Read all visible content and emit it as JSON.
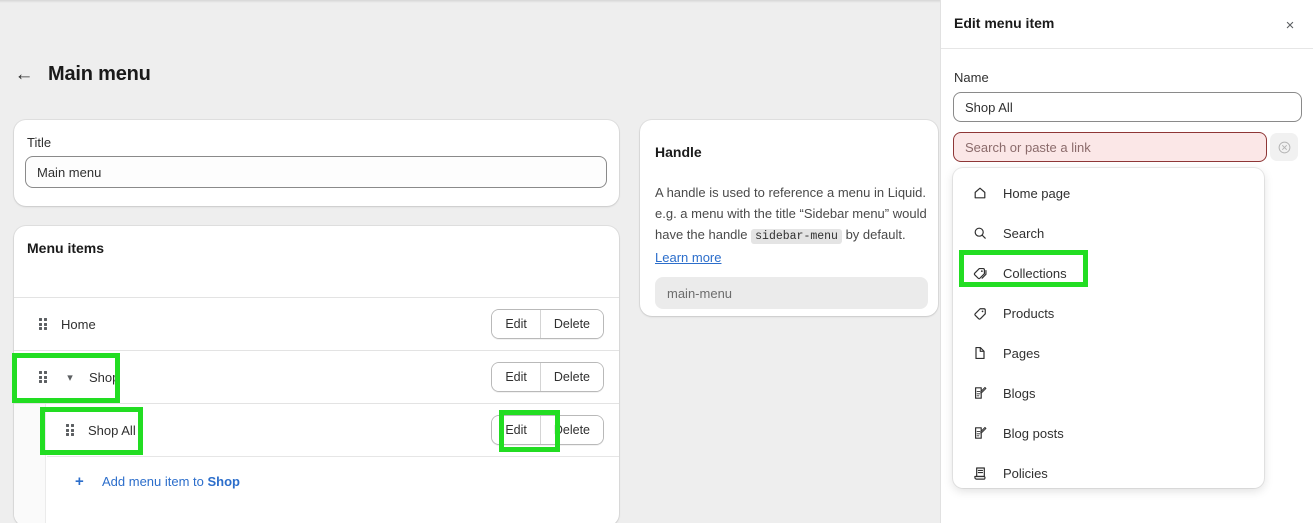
{
  "theme": {
    "accent": "#2c6ecb",
    "highlight": "#22dd22",
    "error_border": "#8e3636",
    "error_bg": "#fbe7e7"
  },
  "main": {
    "back_icon": "←",
    "page_title": "Main menu",
    "title_card": {
      "label": "Title",
      "value": "Main menu"
    },
    "items_card": {
      "heading": "Menu items",
      "rows": [
        {
          "label": "Home",
          "edit": "Edit",
          "delete": "Delete"
        },
        {
          "label": "Shop",
          "edit": "Edit",
          "delete": "Delete"
        },
        {
          "label": "Shop All",
          "edit": "Edit",
          "delete": "Delete"
        }
      ],
      "add": {
        "plus": "+",
        "text_prefix": "Add menu item to ",
        "text_target": "Shop"
      }
    },
    "handle_card": {
      "heading": "Handle",
      "desc_part1": "A handle is used to reference a menu in Liquid. e.g. a menu with the title “Sidebar menu” would have the handle ",
      "desc_code": "sidebar-menu",
      "desc_part2": " by default. ",
      "learn_more": "Learn more",
      "value": "main-menu"
    }
  },
  "panel": {
    "title": "Edit menu item",
    "close_icon": "×",
    "name_label": "Name",
    "name_value": "Shop All",
    "search_placeholder": "Search or paste a link",
    "clear_icon": "⊗",
    "dropdown": [
      {
        "label": "Home page",
        "icon": "home-icon"
      },
      {
        "label": "Search",
        "icon": "search-icon"
      },
      {
        "label": "Collections",
        "icon": "collections-icon"
      },
      {
        "label": "Products",
        "icon": "product-tag-icon"
      },
      {
        "label": "Pages",
        "icon": "page-icon"
      },
      {
        "label": "Blogs",
        "icon": "blog-icon"
      },
      {
        "label": "Blog posts",
        "icon": "blog-post-icon"
      },
      {
        "label": "Policies",
        "icon": "policy-icon"
      }
    ]
  }
}
